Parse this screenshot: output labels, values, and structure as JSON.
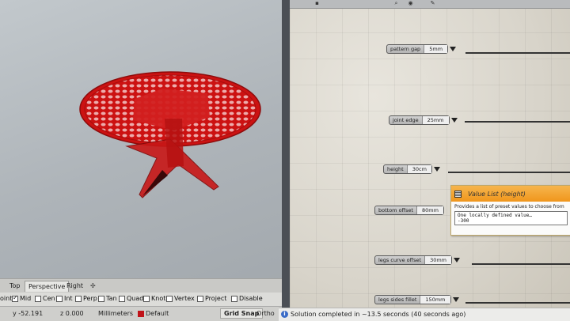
{
  "viewport": {
    "tabs": [
      "Top",
      "Perspective",
      "Right"
    ],
    "add_tab_icon": "plus-icon",
    "model_color": "#d91e1e"
  },
  "osnap": {
    "items": [
      {
        "label": "oint",
        "checked": null
      },
      {
        "label": "Mid",
        "checked": true
      },
      {
        "label": "Cen",
        "checked": false
      },
      {
        "label": "Int",
        "checked": false
      },
      {
        "label": "Perp",
        "checked": false
      },
      {
        "label": "Tan",
        "checked": false
      },
      {
        "label": "Quad",
        "checked": false
      },
      {
        "label": "Knot",
        "checked": false
      },
      {
        "label": "Vertex",
        "checked": false
      },
      {
        "label": "Project",
        "checked": false
      },
      {
        "label": "Disable",
        "checked": false
      }
    ]
  },
  "statusbar": {
    "y": "y -52.191",
    "z": "z 0.000",
    "units": "Millimeters",
    "layer": "Default",
    "grid_snap": "Grid Snap",
    "ortho": "Ortho"
  },
  "gh": {
    "sliders": [
      {
        "label": "pattern gap",
        "value": "5mm"
      },
      {
        "label": "joint edge",
        "value": "25mm"
      },
      {
        "label": "height",
        "value": "30cm"
      },
      {
        "label": "bottom offset",
        "value": "80mm"
      },
      {
        "label": "legs curve offset",
        "value": "30mm"
      },
      {
        "label": "legs sides fillet",
        "value": "150mm"
      }
    ],
    "tooltip": {
      "title": "Value List (height)",
      "description": "Provides a list of preset values to choose from",
      "code_line1": "One locally defined value…",
      "code_line2": "-300"
    },
    "status_message": "Solution completed in ~13.5 seconds (40 seconds ago)",
    "accent": "#f0961c"
  }
}
